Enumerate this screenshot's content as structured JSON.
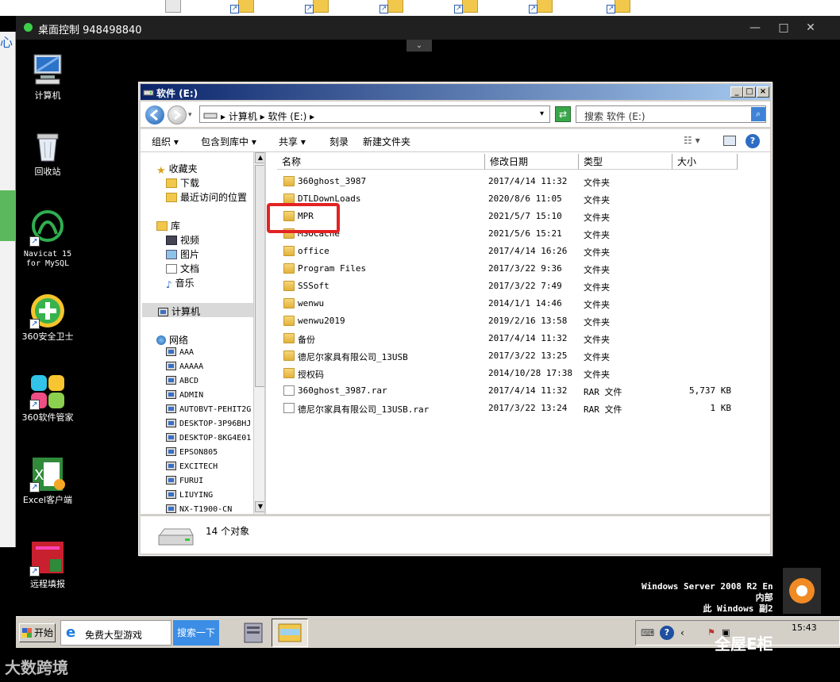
{
  "remote_window": {
    "title": "桌面控制 948498840",
    "minimize": "—",
    "maximize": "□",
    "close": "✕",
    "collapse": "⌄"
  },
  "host_left_text": "心",
  "desktop_icons": [
    {
      "label": "计算机",
      "icon": "computer-icon"
    },
    {
      "label": "回收站",
      "icon": "recycle-bin-icon"
    },
    {
      "label": "Navicat 15\nfor MySQL",
      "icon": "navicat-icon"
    },
    {
      "label": "360安全卫士",
      "icon": "360-security-icon"
    },
    {
      "label": "360软件管家",
      "icon": "360-software-icon"
    },
    {
      "label": "Excel客户端",
      "icon": "excel-client-icon"
    },
    {
      "label": "远程填报",
      "icon": "remote-report-icon"
    }
  ],
  "explorer": {
    "title": "软件 (E:)",
    "address": "▸ 计算机 ▸ 软件 (E:) ▸",
    "search_placeholder": "搜索 软件 (E:)",
    "toolbar": {
      "organize": "组织 ▾",
      "include": "包含到库中 ▾",
      "share": "共享 ▾",
      "burn": "刻录",
      "new_folder": "新建文件夹"
    },
    "nav": {
      "favorites": "收藏夹",
      "downloads": "下载",
      "recent": "最近访问的位置",
      "libraries": "库",
      "videos": "视频",
      "pictures": "图片",
      "documents": "文档",
      "music": "音乐",
      "computer": "计算机",
      "network": "网络",
      "hosts": [
        "AAA",
        "AAAAA",
        "ABCD",
        "ADMIN",
        "AUTOBVT-PEHIT2G",
        "DESKTOP-3P96BHJ",
        "DESKTOP-8KG4E01",
        "EPSON805",
        "EXCITECH",
        "FURUI",
        "LIUYING",
        "NX-T1900-CN"
      ]
    },
    "columns": {
      "name": "名称",
      "date": "修改日期",
      "type": "类型",
      "size": "大小"
    },
    "files": [
      {
        "name": "360ghost_3987",
        "date": "2017/4/14 11:32",
        "type": "文件夹",
        "size": "",
        "kind": "folder"
      },
      {
        "name": "DTLDownLoads",
        "date": "2020/8/6 11:05",
        "type": "文件夹",
        "size": "",
        "kind": "folder"
      },
      {
        "name": "MPR",
        "date": "2021/5/7 15:10",
        "type": "文件夹",
        "size": "",
        "kind": "folder"
      },
      {
        "name": "MSOCache",
        "date": "2021/5/6 15:21",
        "type": "文件夹",
        "size": "",
        "kind": "folder"
      },
      {
        "name": "office",
        "date": "2017/4/14 16:26",
        "type": "文件夹",
        "size": "",
        "kind": "folder"
      },
      {
        "name": "Program Files",
        "date": "2017/3/22 9:36",
        "type": "文件夹",
        "size": "",
        "kind": "folder"
      },
      {
        "name": "SSSoft",
        "date": "2017/3/22 7:49",
        "type": "文件夹",
        "size": "",
        "kind": "folder"
      },
      {
        "name": "wenwu",
        "date": "2014/1/1 14:46",
        "type": "文件夹",
        "size": "",
        "kind": "folder"
      },
      {
        "name": "wenwu2019",
        "date": "2019/2/16 13:58",
        "type": "文件夹",
        "size": "",
        "kind": "folder"
      },
      {
        "name": "备份",
        "date": "2017/4/14 11:32",
        "type": "文件夹",
        "size": "",
        "kind": "folder"
      },
      {
        "name": "德尼尔家具有限公司_13USB",
        "date": "2017/3/22 13:25",
        "type": "文件夹",
        "size": "",
        "kind": "folder"
      },
      {
        "name": "授权码",
        "date": "2014/10/28 17:38",
        "type": "文件夹",
        "size": "",
        "kind": "folder"
      },
      {
        "name": "360ghost_3987.rar",
        "date": "2017/4/14 11:32",
        "type": "RAR 文件",
        "size": "5,737 KB",
        "kind": "file"
      },
      {
        "name": "德尼尔家具有限公司_13USB.rar",
        "date": "2017/3/22 13:24",
        "type": "RAR 文件",
        "size": "1 KB",
        "kind": "file"
      }
    ],
    "status": "14 个对象"
  },
  "watermark": {
    "line1": "Windows Server 2008 R2 En",
    "line2": "内部",
    "line3": "此 Windows 副2"
  },
  "taskbar": {
    "start": "开始",
    "ie_text": "免费大型游戏",
    "search_btn": "搜索一下",
    "clock": "15:43"
  },
  "branding": {
    "left": "大数跨境",
    "right": "全屋E柜"
  }
}
